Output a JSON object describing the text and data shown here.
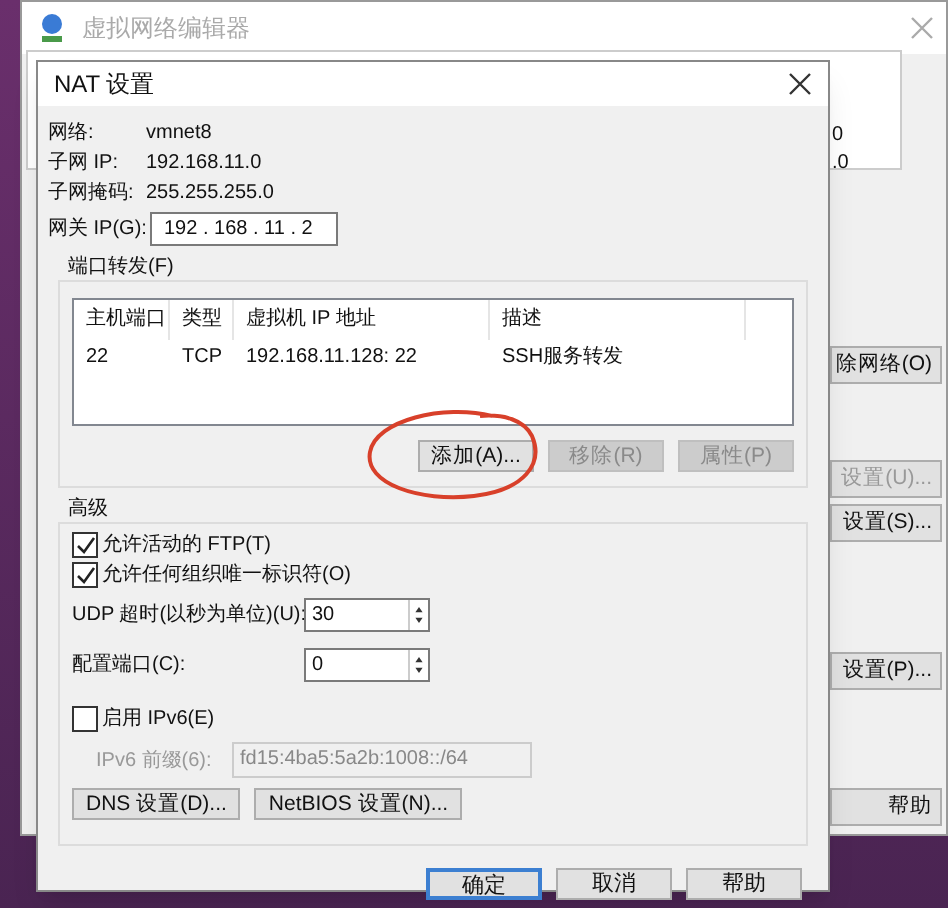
{
  "background_window": {
    "title": "虚拟网络编辑器",
    "side_texts": [
      "0",
      ".0"
    ],
    "buttons": [
      {
        "label": "除网络(O)",
        "disabled": false
      },
      {
        "label": "设置(U)...",
        "disabled": true
      },
      {
        "label": "设置(S)...",
        "disabled": false
      },
      {
        "label": "设置(P)...",
        "disabled": false
      },
      {
        "label": "帮助",
        "disabled": false
      }
    ]
  },
  "dialog": {
    "title": "NAT 设置",
    "info": [
      {
        "label": "网络:",
        "value": "vmnet8"
      },
      {
        "label": "子网 IP:",
        "value": "192.168.11.0"
      },
      {
        "label": "子网掩码:",
        "value": "255.255.255.0"
      }
    ],
    "gateway": {
      "label": "网关 IP(G):",
      "value": "192 . 168 . 11 . 2"
    },
    "port_forwarding": {
      "title": "端口转发(F)",
      "columns": [
        "主机端口",
        "类型",
        "虚拟机 IP 地址",
        "描述"
      ],
      "rows": [
        [
          "22",
          "TCP",
          "192.168.11.128: 22",
          "SSH服务转发"
        ]
      ],
      "buttons": [
        {
          "label": "添加(A)...",
          "disabled": false,
          "circled": true
        },
        {
          "label": "移除(R)",
          "disabled": true,
          "circled": false
        },
        {
          "label": "属性(P)",
          "disabled": true,
          "circled": false
        }
      ]
    },
    "advanced": {
      "title": "高级",
      "checkboxes": [
        {
          "label": "允许活动的 FTP(T)",
          "checked": true
        },
        {
          "label": "允许任何组织唯一标识符(O)",
          "checked": true
        }
      ],
      "spinners": [
        {
          "label": "UDP 超时(以秒为单位)(U):",
          "value": "30"
        },
        {
          "label": "配置端口(C):",
          "value": "0"
        }
      ],
      "ipv6": {
        "label": "启用 IPv6(E)",
        "checked": false,
        "prefix_label": "IPv6 前缀(6):",
        "prefix_value": "fd15:4ba5:5a2b:1008::/64"
      },
      "buttons": [
        "DNS 设置(D)...",
        "NetBIOS 设置(N)..."
      ]
    },
    "footer_buttons": [
      {
        "label": "确定",
        "default": true
      },
      {
        "label": "取消",
        "default": false
      },
      {
        "label": "帮助",
        "default": false
      }
    ]
  }
}
